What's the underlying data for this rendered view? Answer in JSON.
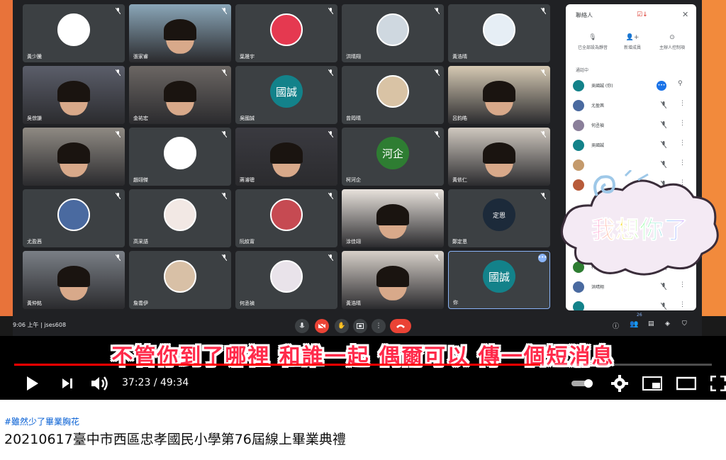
{
  "meet": {
    "tiles": [
      {
        "name": "黃少騰",
        "avatar": "dog-drawing-avatar",
        "type": "avatar",
        "bg": "#ffffff"
      },
      {
        "name": "張家睿",
        "avatar": "",
        "type": "camera",
        "bg": "#8aa6b8"
      },
      {
        "name": "葉晟宇",
        "avatar": "red-slime-avatar",
        "type": "avatar",
        "bg": "#e53950"
      },
      {
        "name": "洪晴翔",
        "avatar": "cartoon-avatar",
        "type": "avatar",
        "bg": "#cfd8e0"
      },
      {
        "name": "黃浩晴",
        "avatar": "shark-avatar",
        "type": "avatar",
        "bg": "#e6eef5"
      },
      {
        "name": "吳倧謙",
        "avatar": "",
        "type": "camera",
        "bg": "#5b5e6a"
      },
      {
        "name": "金祐宏",
        "avatar": "",
        "type": "camera",
        "bg": "#6b6663"
      },
      {
        "name": "吳國誠",
        "avatar": "國誠",
        "type": "letter",
        "bg": "#13828a"
      },
      {
        "name": "曾筠晴",
        "avatar": "cat-avatar",
        "type": "avatar",
        "bg": "#d9c3a5"
      },
      {
        "name": "呂鈞皓",
        "avatar": "",
        "type": "camera",
        "bg": "#d5c9b3"
      },
      {
        "name": "",
        "avatar": "",
        "type": "camera",
        "bg": "#8f8a83"
      },
      {
        "name": "趙翊傑",
        "avatar": "smiley-avatar",
        "type": "avatar",
        "bg": "#ffffff"
      },
      {
        "name": "蔣濬聰",
        "avatar": "",
        "type": "camera",
        "bg": "#3a3a40"
      },
      {
        "name": "柯河企",
        "avatar": "河企",
        "type": "letter",
        "bg": "#2e7d32"
      },
      {
        "name": "黃依仁",
        "avatar": "",
        "type": "camera",
        "bg": "#cfc8bf"
      },
      {
        "name": "尤盈茜",
        "avatar": "anime-avatar",
        "type": "avatar",
        "bg": "#4a6aa0"
      },
      {
        "name": "高采語",
        "avatar": "cat-drawing-avatar",
        "type": "avatar",
        "bg": "#f2e8e4"
      },
      {
        "name": "阮紋甯",
        "avatar": "anime-avatar",
        "type": "avatar",
        "bg": "#c64a52"
      },
      {
        "name": "涂佳翊",
        "avatar": "",
        "type": "camera",
        "bg": "#e8e2dc"
      },
      {
        "name": "鄭定恩",
        "avatar": "定恩",
        "type": "letter",
        "bg": "#1c2a3a"
      },
      {
        "name": "黃仲銘",
        "avatar": "",
        "type": "camera",
        "bg": "#7a7f86"
      },
      {
        "name": "詹喬伊",
        "avatar": "anime-avatar",
        "type": "avatar",
        "bg": "#d8c0a6"
      },
      {
        "name": "何丞禎",
        "avatar": "anime-avatar",
        "type": "avatar",
        "bg": "#e9e3ea"
      },
      {
        "name": "黃浩晴",
        "avatar": "",
        "type": "camera",
        "bg": "#d7d0c9"
      },
      {
        "name": "你",
        "avatar": "國誠",
        "type": "letter",
        "bg": "#13828a"
      }
    ],
    "bar": {
      "time": "9:06 上午",
      "divider": "|",
      "code": "jses608",
      "people_count": "26"
    }
  },
  "panel": {
    "title": "聯絡人",
    "actions": [
      "已全部設為靜音",
      "新增成員",
      "主辦人控制項"
    ],
    "section": "通話中",
    "people": [
      {
        "name": "吳國誠 (你)",
        "color": "#13828a"
      },
      {
        "name": "尤盈茜",
        "color": "#4a6aa0"
      },
      {
        "name": "何丞禎",
        "color": "#8a7f9a"
      },
      {
        "name": "吳國誠",
        "color": "#13828a"
      },
      {
        "name": "",
        "color": "#c49a6c"
      },
      {
        "name": "",
        "color": "#b85b3a"
      },
      {
        "name": "柯河企",
        "color": "#2e7d32"
      },
      {
        "name": "洪晴翔",
        "color": "#4a6aa0"
      },
      {
        "name": "",
        "color": "#13828a"
      }
    ]
  },
  "sticker": {
    "text": "我想你了"
  },
  "subtitle": "不管你到了哪裡 和誰一起 偶爾可以 傳一個短消息",
  "player": {
    "current": "37:23",
    "separator": "/",
    "duration": "49:34",
    "progress": 0.754
  },
  "below": {
    "hashtag": "#雖然少了畢業胸花",
    "title": "20210617臺中市西區忠孝國民小學第76屆線上畢業典禮"
  },
  "colors": {
    "accent_red": "#ff0000",
    "subtitle_red": "#ff2a4a",
    "meet_bg": "#202124",
    "tile_bg": "#3c4043",
    "link": "#065fd4"
  }
}
